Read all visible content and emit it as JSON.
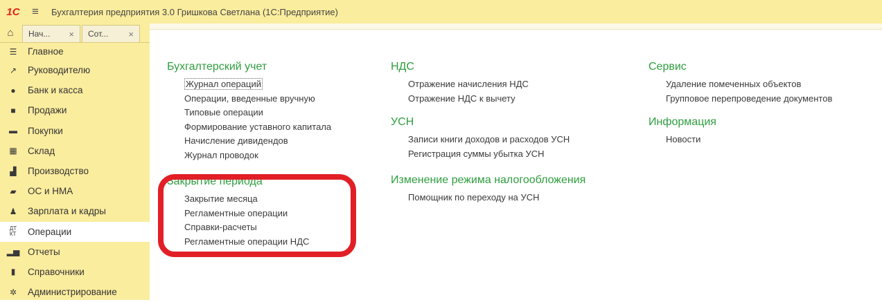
{
  "window": {
    "logo": "1С",
    "title": "Бухгалтерия предприятия 3.0 Гришкова Светлана  (1С:Предприятие)"
  },
  "tabs": [
    {
      "label": "Нач..."
    },
    {
      "label": "Сот..."
    }
  ],
  "sidebar": {
    "items": [
      {
        "label": "Главное",
        "icon": "menu-lines-icon"
      },
      {
        "label": "Руководителю",
        "icon": "trend-icon"
      },
      {
        "label": "Банк и касса",
        "icon": "coin-icon"
      },
      {
        "label": "Продажи",
        "icon": "bag-icon"
      },
      {
        "label": "Покупки",
        "icon": "cart-icon"
      },
      {
        "label": "Склад",
        "icon": "warehouse-icon"
      },
      {
        "label": "Производство",
        "icon": "factory-icon"
      },
      {
        "label": "ОС и НМА",
        "icon": "truck-icon"
      },
      {
        "label": "Зарплата и кадры",
        "icon": "person-icon"
      },
      {
        "label": "Операции",
        "icon": "dt-kt-icon",
        "active": true
      },
      {
        "label": "Отчеты",
        "icon": "bar-chart-icon"
      },
      {
        "label": "Справочники",
        "icon": "book-icon"
      },
      {
        "label": "Администрирование",
        "icon": "gear-icon"
      }
    ]
  },
  "content": {
    "accounting": {
      "heading": "Бухгалтерский учет",
      "links": [
        "Журнал операций",
        "Операции, введенные вручную",
        "Типовые операции",
        "Формирование уставного капитала",
        "Начисление дивидендов",
        "Журнал проводок"
      ]
    },
    "period_close": {
      "heading": "Закрытие периода",
      "links": [
        "Закрытие месяца",
        "Регламентные операции",
        "Справки-расчеты",
        "Регламентные операции НДС"
      ]
    },
    "vat": {
      "heading": "НДС",
      "links": [
        "Отражение начисления НДС",
        "Отражение НДС к вычету"
      ]
    },
    "usn": {
      "heading": "УСН",
      "links": [
        "Записи книги доходов и расходов УСН",
        "Регистрация суммы убытка УСН"
      ]
    },
    "tax_change": {
      "heading": "Изменение режима налогообложения",
      "links": [
        "Помощник по переходу на УСН"
      ]
    },
    "service": {
      "heading": "Сервис",
      "links": [
        "Удаление помеченных объектов",
        "Групповое перепроведение документов"
      ]
    },
    "info": {
      "heading": "Информация",
      "links": [
        "Новости"
      ]
    }
  },
  "colors": {
    "heading": "#2e9d3e",
    "sidebar_bg": "#fbed9e",
    "highlight": "#e21f26"
  }
}
